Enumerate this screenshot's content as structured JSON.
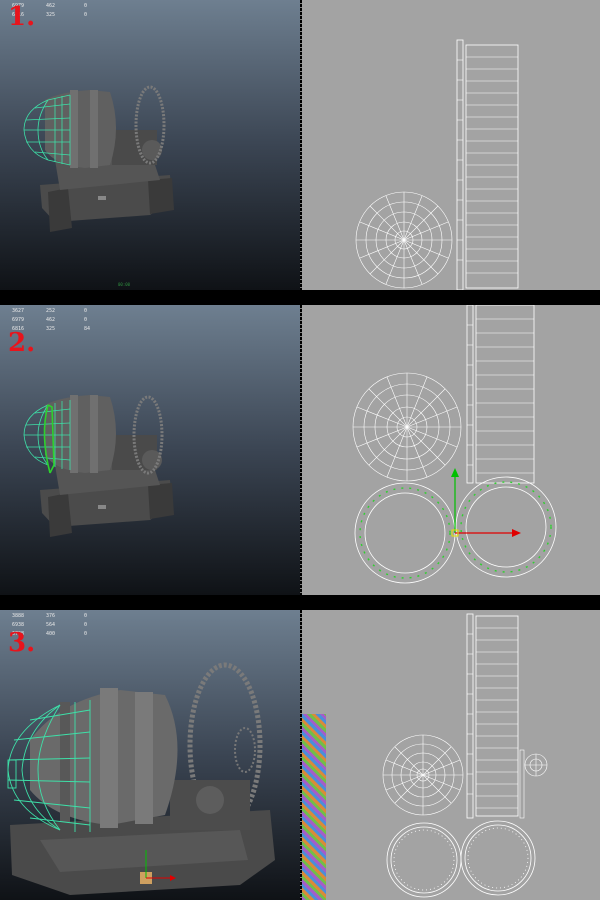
{
  "steps": [
    {
      "label": "1.",
      "hud": [
        {
          "c1": "6979",
          "c2": "462",
          "c3": "0"
        },
        {
          "c1": "6816",
          "c2": "325",
          "c3": "0"
        }
      ],
      "status_text": "00:00"
    },
    {
      "label": "2.",
      "hud": [
        {
          "c1": "3627",
          "c2": "252",
          "c3": "0"
        },
        {
          "c1": "6979",
          "c2": "462",
          "c3": "0"
        },
        {
          "c1": "6816",
          "c2": "325",
          "c3": "84"
        }
      ]
    },
    {
      "label": "3.",
      "hud": [
        {
          "c1": "3888",
          "c2": "376",
          "c3": "0"
        },
        {
          "c1": "6938",
          "c2": "564",
          "c3": "0"
        },
        {
          "c1": "6798",
          "c2": "400",
          "c3": "0"
        }
      ]
    }
  ],
  "colors": {
    "step_label": "#e8141c",
    "wire_selected": "#3ee0a8",
    "uv_wire": "#ffffff",
    "uv_bg": "#a3a3a3",
    "manip_x": "#e00000",
    "manip_y": "#00c000",
    "selected_uv": "#2dd12d"
  }
}
